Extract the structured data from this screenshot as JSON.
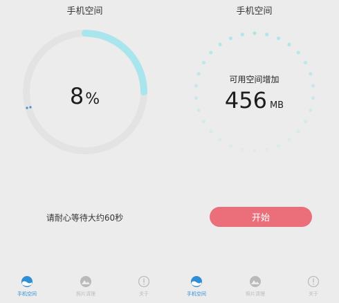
{
  "left": {
    "title": "手机空间",
    "progress_value": "8",
    "progress_unit": "%",
    "progress_fraction": 0.08,
    "wait_text": "请耐心等待大约60秒"
  },
  "right": {
    "title": "手机空间",
    "available_label": "可用空间增加",
    "available_value": "456",
    "available_unit": "MB",
    "start_label": "开始"
  },
  "tabs": [
    {
      "label": "手机空间",
      "icon": "phone-space-icon",
      "active": true
    },
    {
      "label": "照片清理",
      "icon": "photo-clean-icon",
      "active": false
    },
    {
      "label": "关于",
      "icon": "info-icon",
      "active": false
    }
  ],
  "colors": {
    "accent_ring": "#a8e5ec",
    "start_button": "#ea6f7a",
    "active_tab": "#2f8fd6",
    "background": "#ececec"
  }
}
